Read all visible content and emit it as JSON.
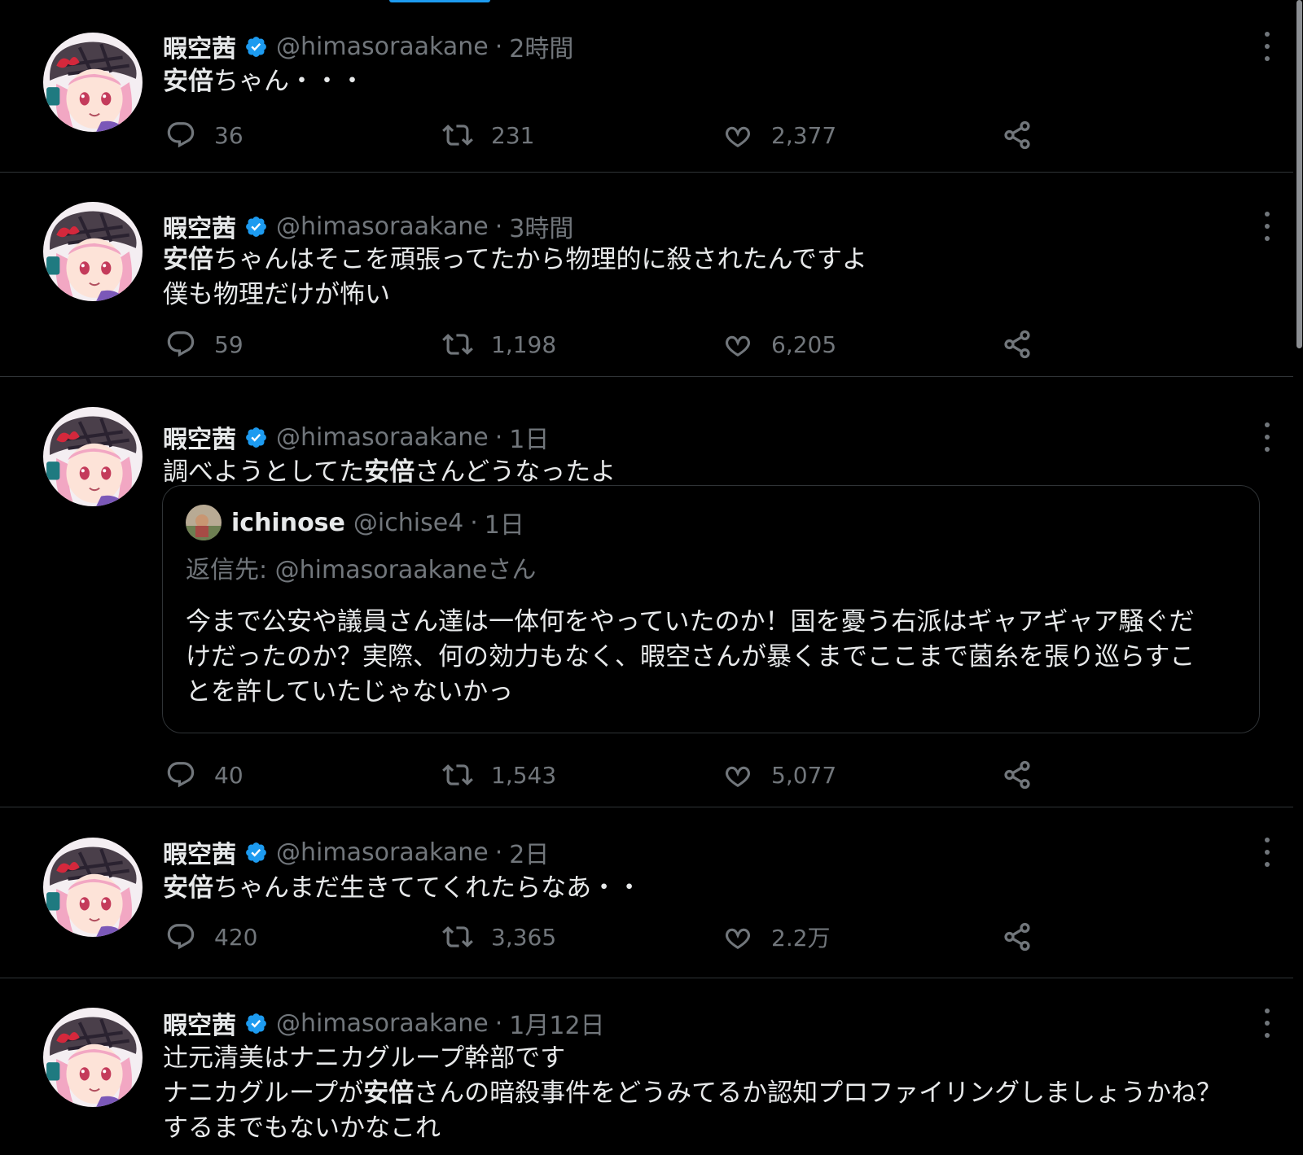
{
  "user": {
    "name": "暇空茜",
    "handle": "@himasoraakane"
  },
  "tweets": [
    {
      "time": "2時間",
      "lines": [
        [
          {
            "b": "安倍"
          },
          {
            "t": "ちゃん・・・"
          }
        ]
      ],
      "replies": "36",
      "retweets": "231",
      "likes": "2,377"
    },
    {
      "time": "3時間",
      "lines": [
        [
          {
            "b": "安倍"
          },
          {
            "t": "ちゃんはそこを頑張ってたから物理的に殺されたんですよ"
          }
        ],
        [
          {
            "t": "僕も物理だけが怖い"
          }
        ]
      ],
      "replies": "59",
      "retweets": "1,198",
      "likes": "6,205"
    },
    {
      "time": "1日",
      "lines": [
        [
          {
            "t": "調べようとしてた"
          },
          {
            "b": "安倍"
          },
          {
            "t": "さんどうなったよ"
          }
        ]
      ],
      "replies": "40",
      "retweets": "1,543",
      "likes": "5,077",
      "quote": {
        "name": "ichinose",
        "handle": "@ichise4",
        "time": "1日",
        "reply_to": "返信先: @himasoraakaneさん",
        "lines": [
          "今まで公安や議員さん達は一体何をやっていたのか！国を憂う右派はギャアギャア騒ぐだ",
          "けだったのか？実際、何の効力もなく、暇空さんが暴くまでここまで菌糸を張り巡らすこ",
          "とを許していたじゃないかっ"
        ]
      }
    },
    {
      "time": "2日",
      "lines": [
        [
          {
            "b": "安倍"
          },
          {
            "t": "ちゃんまだ生きててくれたらなあ・・"
          }
        ]
      ],
      "replies": "420",
      "retweets": "3,365",
      "likes": "2.2万"
    },
    {
      "time": "1月12日",
      "lines": [
        [
          {
            "t": "辻元清美はナニカグループ幹部です"
          }
        ],
        [
          {
            "t": "ナニカグループが"
          },
          {
            "b": "安倍"
          },
          {
            "t": "さんの暗殺事件をどうみてるか認知プロファイリングしましょうかね？"
          }
        ],
        [
          {
            "t": "するまでもないかなこれ"
          }
        ]
      ]
    }
  ],
  "colors": {
    "background": "#000000",
    "text": "#e7e9ea",
    "muted": "#71767b",
    "border": "#2f3336",
    "verified": "#1d9bf0"
  },
  "icons": [
    "verified-badge-icon",
    "more-icon",
    "reply-icon",
    "retweet-icon",
    "like-icon",
    "share-icon"
  ]
}
